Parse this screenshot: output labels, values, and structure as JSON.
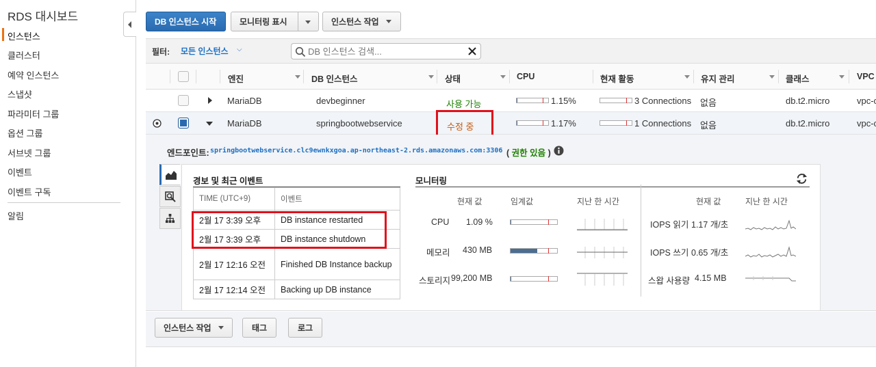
{
  "sidebar": {
    "title": "RDS 대시보드",
    "items": [
      "인스턴스",
      "클러스터",
      "예약 인스턴스",
      "스냅샷",
      "파라미터 그룹",
      "옵션 그룹",
      "서브넷 그룹",
      "이벤트",
      "이벤트 구독"
    ],
    "alerts": "알림"
  },
  "toolbar": {
    "launch": "DB 인스턴스 시작",
    "monitoring": "모니터링 표시",
    "instance_actions": "인스턴스 작업"
  },
  "filter": {
    "label": "필터:",
    "value": "모든 인스턴스",
    "search_placeholder": "DB 인스턴스 검색..."
  },
  "table": {
    "headers": [
      "엔진",
      "DB 인스턴스",
      "상태",
      "CPU",
      "현재 활동",
      "유지 관리",
      "클래스",
      "VPC"
    ],
    "rows": [
      {
        "engine": "MariaDB",
        "instance": "devbeginner",
        "status": "사용 가능",
        "cpu": "1.15%",
        "cpu_level": 0.0115,
        "activity": "3 Connections",
        "maintenance": "없음",
        "class": "db.t2.micro",
        "vpc": "vpc-c",
        "selected": false
      },
      {
        "engine": "MariaDB",
        "instance": "springbootwebservice",
        "status": "수정 중",
        "cpu": "1.17%",
        "cpu_level": 0.0117,
        "activity": "1 Connections",
        "maintenance": "없음",
        "class": "db.t2.micro",
        "vpc": "vpc-c",
        "selected": true
      }
    ]
  },
  "details": {
    "endpoint_label": "엔드포인트:",
    "endpoint_value": "springbootwebservice.clc9ewnkxgoa.ap-northeast-2.rds.amazonaws.com:3306",
    "endpoint_auth_open": "(",
    "endpoint_auth": "권한 있음",
    "endpoint_auth_close": ")",
    "events_title": "경보 및 최근 이벤트",
    "events_headers": [
      "TIME (UTC+9)",
      "이벤트"
    ],
    "events": [
      {
        "time": "2월 17 3:39 오후",
        "event": "DB instance restarted"
      },
      {
        "time": "2월 17 3:39 오후",
        "event": "DB instance shutdown"
      },
      {
        "time": "2월 17 12:16 오전",
        "event": "Finished DB Instance backup"
      },
      {
        "time": "2월 17 12:14 오전",
        "event": "Backing up DB instance"
      }
    ],
    "monitoring_title": "모니터링",
    "monitoring_headers_left": [
      "현재 값",
      "임계값",
      "지난 한 시간"
    ],
    "monitoring_headers_right": [
      "현재 값",
      "지난 한 시간"
    ],
    "metrics_left": [
      {
        "label": "CPU",
        "value": "1.09 %",
        "level": 0.0109
      },
      {
        "label": "메모리",
        "value": "430 MB",
        "level": 0.58
      },
      {
        "label": "스토리지",
        "value": "99,200 MB",
        "level": 0.01
      }
    ],
    "metrics_right": [
      {
        "label": "IOPS 읽기",
        "value": "1.17 개/초"
      },
      {
        "label": "IOPS 쓰기",
        "value": "0.65 개/초"
      },
      {
        "label": "스왑 사용량",
        "value": "4.15 MB"
      }
    ]
  },
  "bottom": {
    "instance_actions": "인스턴스 작업",
    "tags": "태그",
    "logs": "로그"
  }
}
